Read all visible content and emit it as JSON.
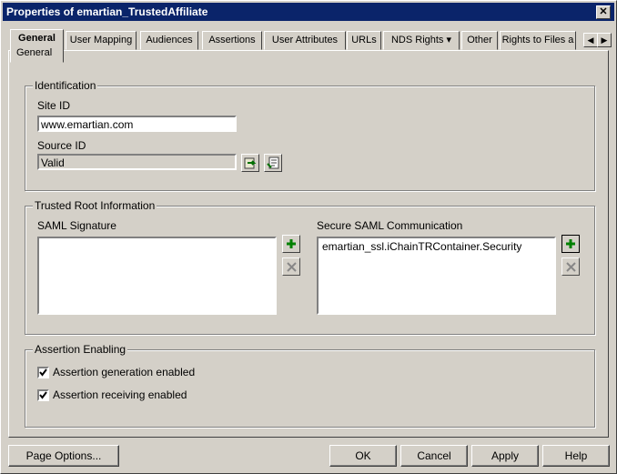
{
  "window": {
    "title": "Properties of emartian_TrustedAffiliate",
    "close_label": "✕"
  },
  "tabs": [
    {
      "label": "General",
      "sub": "General"
    },
    {
      "label": "User Mapping"
    },
    {
      "label": "Audiences"
    },
    {
      "label": "Assertions"
    },
    {
      "label": "User Attributes"
    },
    {
      "label": "URLs"
    },
    {
      "label": "NDS Rights ▾"
    },
    {
      "label": "Other"
    },
    {
      "label": "Rights to Files a"
    }
  ],
  "identification": {
    "legend": "Identification",
    "site_id_label": "Site ID",
    "site_id_value": "www.emartian.com",
    "source_id_label": "Source ID",
    "source_id_value": "Valid"
  },
  "trusted_root": {
    "legend": "Trusted Root Information",
    "saml_signature_label": "SAML Signature",
    "saml_signature_items": [],
    "secure_saml_label": "Secure SAML Communication",
    "secure_saml_items": [
      "emartian_ssl.iChainTRContainer.Security"
    ]
  },
  "assertion_enabling": {
    "legend": "Assertion Enabling",
    "generation_label": "Assertion generation enabled",
    "generation_checked": true,
    "receiving_label": "Assertion receiving enabled",
    "receiving_checked": true
  },
  "buttons": {
    "page_options": "Page Options...",
    "ok": "OK",
    "cancel": "Cancel",
    "apply": "Apply",
    "help": "Help"
  }
}
